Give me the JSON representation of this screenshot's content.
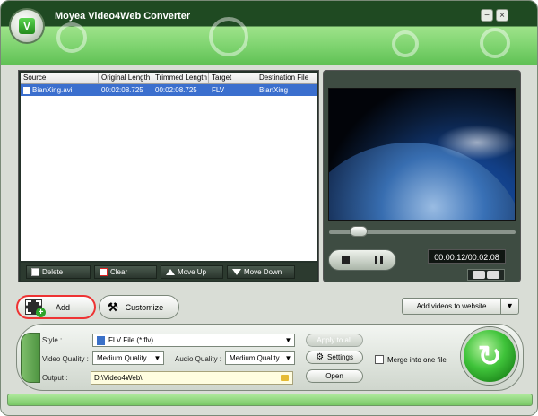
{
  "window": {
    "title": "Moyea Video4Web Converter",
    "logo_letter": "V"
  },
  "window_controls": {
    "minimize": "−",
    "close": "×"
  },
  "file_table": {
    "columns": [
      "Source",
      "Original Length",
      "Trimmed Length",
      "Target",
      "Destination File"
    ],
    "rows": [
      {
        "source": "BianXing.avi",
        "original": "00:02:08.725",
        "trimmed": "00:02:08.725",
        "target": "FLV",
        "destination": "BianXing"
      }
    ]
  },
  "list_toolbar": {
    "delete": "Delete",
    "clear": "Clear",
    "move_up": "Move Up",
    "move_down": "Move Down"
  },
  "player": {
    "time": "00:00:12/00:02:08",
    "seek_fraction": 0.12
  },
  "buttons": {
    "add": "Add",
    "customize": "Customize",
    "add_videos_to_website": "Add videos to website"
  },
  "settings": {
    "style_label": "Style :",
    "style_value": "FLV File (*.flv)",
    "video_quality_label": "Video Quality :",
    "video_quality_value": "Medium Quality",
    "audio_quality_label": "Audio Quality :",
    "audio_quality_value": "Medium Quality",
    "output_label": "Output :",
    "output_value": "D:\\Video4Web\\",
    "apply_to_all": "Apply to all",
    "settings_btn": "Settings",
    "open_btn": "Open",
    "merge_label": "Merge into one file"
  },
  "colors": {
    "accent_green": "#5fc054",
    "selection_blue": "#3b6fce",
    "add_highlight": "#ee3333"
  }
}
